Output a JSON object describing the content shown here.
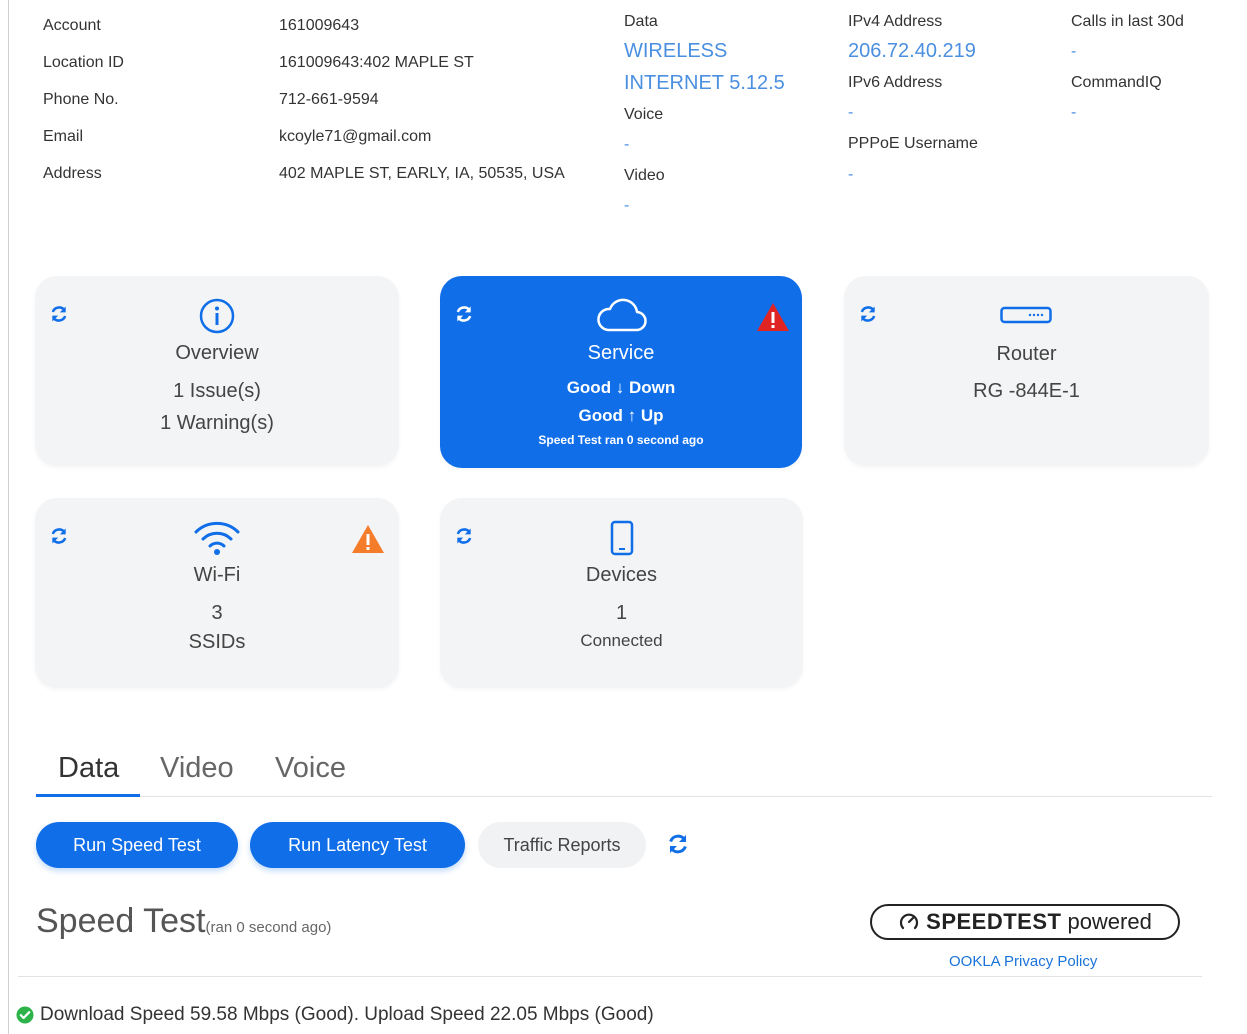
{
  "subscriber": {
    "rows": [
      {
        "label": "Account",
        "value": "161009643"
      },
      {
        "label": "Location ID",
        "value": "161009643:402 MAPLE ST"
      },
      {
        "label": "Phone No.",
        "value": "712-661-9594"
      },
      {
        "label": "Email",
        "value": "kcoyle71@gmail.com"
      },
      {
        "label": "Address",
        "value": "402 MAPLE ST, EARLY, IA, 50535, USA"
      }
    ]
  },
  "services": {
    "data_label": "Data",
    "data_value_line1": "WIRELESS",
    "data_value_line2": "INTERNET 5.12.5",
    "voice_label": "Voice",
    "voice_value": "-",
    "video_label": "Video",
    "video_value": "-"
  },
  "network": {
    "ipv4_label": "IPv4 Address",
    "ipv4_value": "206.72.40.219",
    "ipv6_label": "IPv6 Address",
    "ipv6_value": "-",
    "pppoe_label": "PPPoE Username",
    "pppoe_value": "-"
  },
  "extra": {
    "calls_label": "Calls in last 30d",
    "calls_value": "-",
    "commandiq_label": "CommandIQ",
    "commandiq_value": "-"
  },
  "tiles": {
    "overview": {
      "title": "Overview",
      "line1": "1 Issue(s)",
      "line2": "1 Warning(s)"
    },
    "service": {
      "title": "Service",
      "down_text": "Good ↓ Down",
      "up_text": "Good ↑ Up",
      "note": "Speed Test ran 0 second ago"
    },
    "router": {
      "title": "Router",
      "model": "RG -844E-1"
    },
    "wifi": {
      "title": "Wi-Fi",
      "count": "3",
      "unit": "SSIDs"
    },
    "devices": {
      "title": "Devices",
      "count": "1",
      "unit": "Connected"
    }
  },
  "tabs": [
    {
      "label": "Data",
      "active": true
    },
    {
      "label": "Video",
      "active": false
    },
    {
      "label": "Voice",
      "active": false
    }
  ],
  "actions": {
    "speed_test": "Run Speed Test",
    "latency_test": "Run Latency Test",
    "traffic_reports": "Traffic Reports"
  },
  "speed_test": {
    "title": "Speed Test",
    "subtitle": "(ran 0 second ago)",
    "badge_strong": "SPEEDTEST",
    "badge_light": "powered",
    "policy_link": "OOKLA Privacy Policy",
    "result": "Download Speed 59.58 Mbps (Good). Upload Speed 22.05 Mbps (Good)"
  },
  "colors": {
    "accent": "#0f6ee8",
    "link": "#4a8fe0",
    "critical": "#e02424",
    "warning": "#f47c2a",
    "success": "#2db34a"
  },
  "icons": {
    "refresh": "refresh-icon",
    "overview": "info-icon",
    "service": "cloud-icon",
    "router": "router-icon",
    "wifi": "wifi-icon",
    "devices": "phone-icon",
    "critical": "critical-alert-icon",
    "warning": "warning-icon",
    "success": "check-circle-icon",
    "speedtest": "gauge-icon"
  }
}
